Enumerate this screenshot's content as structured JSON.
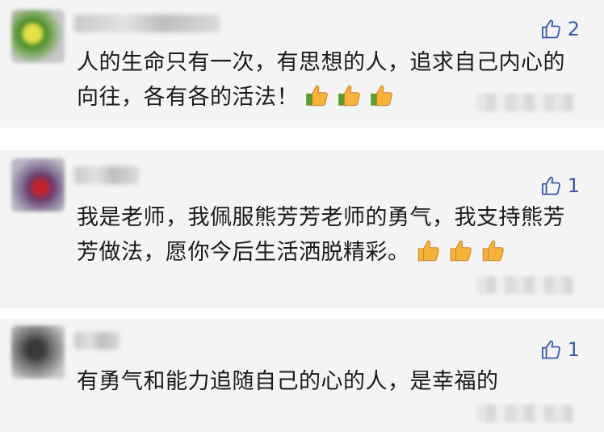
{
  "comments": [
    {
      "likes": "2",
      "text": "人的生命只有一次，有思想的人，追求自己内心的向往，各有各的活法！",
      "trailing_emoji_count": 3
    },
    {
      "likes": "1",
      "text": "我是老师，我佩服熊芳芳老师的勇气，我支持熊芳芳做法，愿你今后生活洒脱精彩。",
      "trailing_emoji_count": 3
    },
    {
      "likes": "1",
      "text": "有勇气和能力追随自己的心的人，是幸福的",
      "trailing_emoji_count": 0
    }
  ],
  "colors": {
    "like_blue": "#3b5aa8",
    "card_bg": "#f4f4f4",
    "text": "#1a1a1a"
  },
  "icons": {
    "like": "thumbs-up-outline-icon",
    "emoji": "thumbs-up-emoji-icon"
  }
}
